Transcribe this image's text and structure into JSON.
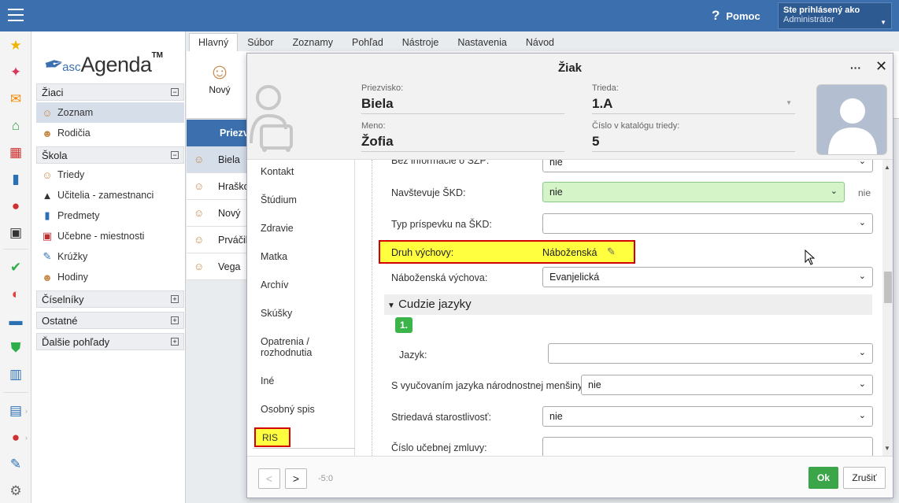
{
  "topbar": {
    "help": "Pomoc",
    "logged_in_label": "Ste prihlásený ako",
    "user": "Administrátor"
  },
  "logo": {
    "small": "asc",
    "big": "Agenda",
    "tm": "TM"
  },
  "nav": {
    "sections": [
      {
        "label": "Žiaci",
        "toggle": "−"
      },
      {
        "label": "Škola",
        "toggle": "−"
      },
      {
        "label": "Číselníky",
        "toggle": "+"
      },
      {
        "label": "Ostatné",
        "toggle": "+"
      },
      {
        "label": "Ďalšie pohľady",
        "toggle": "+"
      }
    ],
    "zoznam": "Zoznam",
    "rodicia": "Rodičia",
    "triedy": "Triedy",
    "ucitelia": "Učitelia - zamestnanci",
    "predmety": "Predmety",
    "ucebne": "Učebne - miestnosti",
    "kruzky": "Krúžky",
    "hodiny": "Hodiny"
  },
  "menu_tabs": [
    "Hlavný",
    "Súbor",
    "Zoznamy",
    "Pohľad",
    "Nástroje",
    "Nastavenia",
    "Návod"
  ],
  "ribbon": {
    "new_label": "Nový"
  },
  "grid": {
    "header": "Priezv",
    "rows": [
      "Biela",
      "Hraško",
      "Nový",
      "Prváčik",
      "Vega"
    ]
  },
  "dialog": {
    "title": "Žiak",
    "more": "···",
    "close": "✕",
    "priezvisko_label": "Priezvisko:",
    "priezvisko": "Biela",
    "meno_label": "Meno:",
    "meno": "Žofia",
    "trieda_label": "Trieda:",
    "trieda": "1.A",
    "katalog_label": "Číslo v katalógu triedy:",
    "katalog": "5",
    "side_tabs": [
      "Kontakt",
      "Štúdium",
      "Zdravie",
      "Matka",
      "Archív",
      "Skúšky",
      "Opatrenia / rozhodnutia",
      "Iné",
      "Osobný spis"
    ],
    "ris_tab": "RIS",
    "fields": {
      "top_cut_label": "Bez informácie o ŠZP:",
      "top_cut_value": "nie",
      "skd_label": "Navštevuje ŠKD:",
      "skd_value": "nie",
      "skd_extra": "nie",
      "prispevok_label": "Typ príspevku na ŠKD:",
      "prispevok_value": "",
      "druh_label": "Druh výchovy:",
      "druh_value": "Náboženská",
      "nabozenska_label": "Náboženská výchova:",
      "nabozenska_value": "Evanjelická",
      "group_title": "Cudzie jazyky",
      "group_num": "1.",
      "jazyk_label": "Jazyk:",
      "jazyk_value": "",
      "mensina_label": "S vyučovaním jazyka národnostnej menšiny:",
      "mensina_value": "nie",
      "striedava_label": "Striedavá starostlivosť:",
      "striedava_value": "nie",
      "zmluva_label": "Číslo učebnej zmluvy:",
      "zmluva_value": ""
    },
    "footer": {
      "prev": "<",
      "next": ">",
      "position": "-5:0",
      "ok": "Ok",
      "cancel": "Zrušiť"
    }
  }
}
